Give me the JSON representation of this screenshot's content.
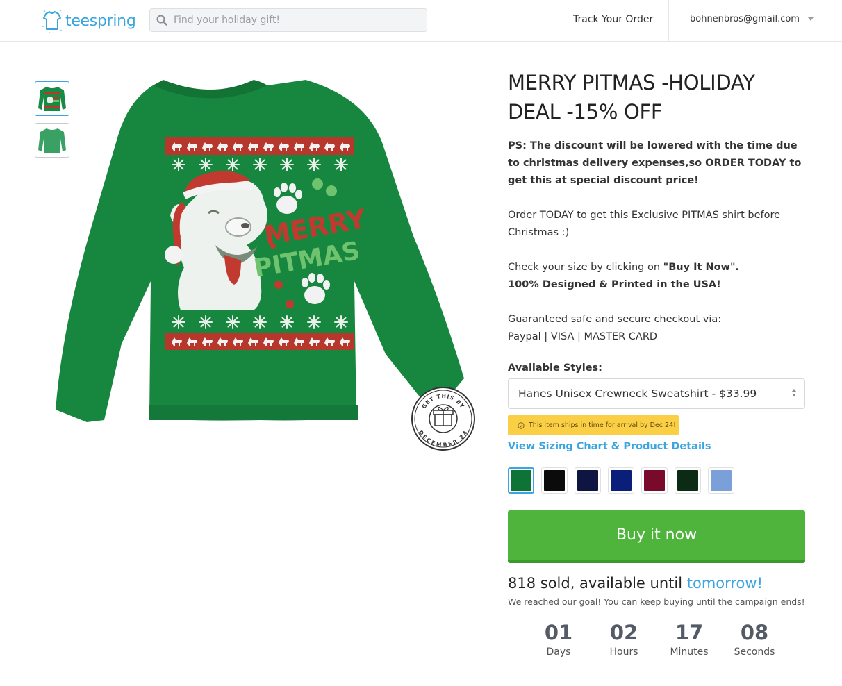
{
  "header": {
    "logo_text": "teespring",
    "search_placeholder": "Find your holiday gift!",
    "track_order": "Track Your Order",
    "account_email": "bohnenbros@gmail.com"
  },
  "product": {
    "title": "MERRY PITMAS -HOLIDAY DEAL -15% OFF",
    "desc_bold_1": "PS: The discount will be lowered with the time due to christmas delivery expenses,so ORDER TODAY to get this at special discount price!",
    "desc_2": "Order TODAY to get this Exclusive PITMAS shirt before Christmas :)",
    "desc_3a": "Check your size by clicking on ",
    "desc_3b": "\"Buy It Now\".",
    "desc_3c": "100% Designed & Printed in the USA!",
    "desc_4a": "Guaranteed safe and secure checkout via:",
    "desc_4b": "Paypal | VISA | MASTER CARD",
    "shirt_text_1": "MERRY",
    "shirt_text_2": "PITMAS",
    "stamp_top": "GET THIS BY",
    "stamp_bottom": "DECEMBER 24"
  },
  "styles": {
    "label": "Available Styles:",
    "selected": "Hanes Unisex Crewneck Sweatshirt - $33.99"
  },
  "ship_badge": "This item ships in time for arrival by Dec 24!",
  "sizing_link": "View Sizing Chart & Product Details",
  "colors": [
    "#0d7336",
    "#0b0b0b",
    "#0e1540",
    "#0a1f7a",
    "#790a2c",
    "#0b2b14",
    "#7b9fd8"
  ],
  "buy_button": "Buy it now",
  "sold": {
    "prefix": "818 sold, available until ",
    "highlight": "tomorrow!",
    "goal": "We reached our goal! You can keep buying until the campaign ends!"
  },
  "countdown": [
    {
      "value": "01",
      "label": "Days"
    },
    {
      "value": "02",
      "label": "Hours"
    },
    {
      "value": "17",
      "label": "Minutes"
    },
    {
      "value": "08",
      "label": "Seconds"
    }
  ]
}
